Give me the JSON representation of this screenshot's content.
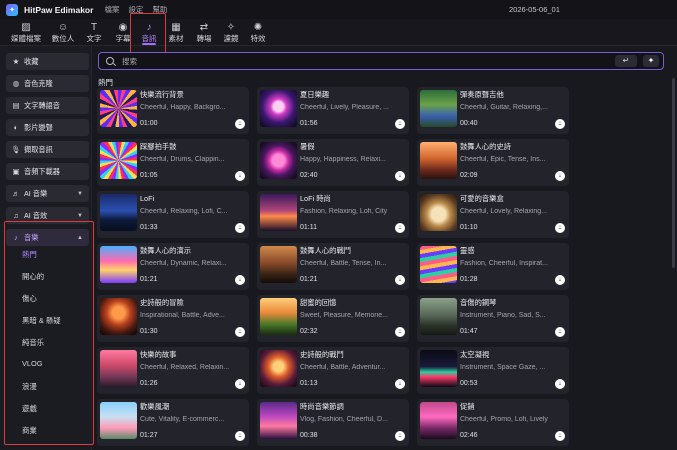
{
  "app": {
    "name": "HitPaw Edimakor",
    "menu": [
      "檔案",
      "設定",
      "幫助"
    ],
    "project_name": "2026-05-06_01"
  },
  "toolbar": [
    {
      "label": "媒體檔案",
      "icon": "media-icon"
    },
    {
      "label": "數位人",
      "icon": "avatar-icon"
    },
    {
      "label": "文字",
      "icon": "text-icon"
    },
    {
      "label": "字幕",
      "icon": "subtitle-icon"
    },
    {
      "label": "音訊",
      "icon": "music-note-icon",
      "active": true
    },
    {
      "label": "素材",
      "icon": "stickers-icon"
    },
    {
      "label": "轉場",
      "icon": "transition-icon"
    },
    {
      "label": "濾鏡",
      "icon": "filter-icon"
    },
    {
      "label": "特效",
      "icon": "effects-icon"
    }
  ],
  "sidebar": {
    "buttons": [
      {
        "label": "收藏",
        "icon": "star-icon"
      },
      {
        "label": "音色克隆",
        "icon": "voice-clone-icon"
      },
      {
        "label": "文字轉語音",
        "icon": "tts-icon"
      },
      {
        "label": "影片變聲",
        "icon": "voice-changer-icon"
      },
      {
        "label": "擷取音訊",
        "icon": "microphone-icon"
      },
      {
        "label": "音頻下載器",
        "icon": "download-icon"
      },
      {
        "label": "AI 音樂",
        "icon": "ai-music-icon",
        "dropdown": true
      },
      {
        "label": "AI 音效",
        "icon": "ai-sfx-icon",
        "dropdown": true
      },
      {
        "label": "音樂",
        "icon": "music-note-icon",
        "dropdown": true,
        "open": true
      }
    ],
    "sub_items": [
      "熱門",
      "開心的",
      "傷心",
      "黑暗 & 懸疑",
      "純音乐",
      "VLOG",
      "浪漫",
      "遊戲",
      "商業"
    ],
    "active_sub": "熱門"
  },
  "search": {
    "placeholder": "搜索",
    "value": ""
  },
  "section_title": "熱門",
  "tracks": [
    {
      "title": "快樂流行背景",
      "tags": "Cheerful, Happy, Backgro...",
      "duration": "01:00"
    },
    {
      "title": "夏日樂趣",
      "tags": "Cheerful, Lively, Pleasure, ...",
      "duration": "01:56"
    },
    {
      "title": "彈奏原聲吉他",
      "tags": "Cheerful, Guitar, Relaxing,...",
      "duration": "00:40"
    },
    {
      "title": "踩腳拍手鼓",
      "tags": "Cheerful, Drums, Clappin...",
      "duration": "01:05"
    },
    {
      "title": "暑假",
      "tags": "Happy, Happiness, Relaxi...",
      "duration": "02:40"
    },
    {
      "title": "鼓舞人心的史詩",
      "tags": "Cheerful, Epic, Tense, Ins...",
      "duration": "02:09"
    },
    {
      "title": "LoFi",
      "tags": "Cheerful, Relaxing, Lofi, C...",
      "duration": "01:33"
    },
    {
      "title": "LoFi 時尚",
      "tags": "Fashion, Relaxing, Lofi, City",
      "duration": "01:11"
    },
    {
      "title": "可愛的音樂盒",
      "tags": "Cheerful, Lovely, Relaxing...",
      "duration": "01:10"
    },
    {
      "title": "鼓舞人心的演示",
      "tags": "Cheerful, Dynamic, Relaxi...",
      "duration": "01:21"
    },
    {
      "title": "鼓舞人心的戰鬥",
      "tags": "Cheerful, Battle, Tense, In...",
      "duration": "01:21"
    },
    {
      "title": "靈感",
      "tags": "Fashion, Cheerful, Inspirat...",
      "duration": "01:28"
    },
    {
      "title": "史詩般的冒險",
      "tags": "Inspirational, Battle, Adve...",
      "duration": "01:30"
    },
    {
      "title": "甜蜜的回憶",
      "tags": "Sweet, Pleasure, Memorie...",
      "duration": "02:32"
    },
    {
      "title": "音傷的鋼琴",
      "tags": "Instrument, Piano, Sad, S...",
      "duration": "01:47"
    },
    {
      "title": "快樂的故事",
      "tags": "Cheerful, Relaxed, Relaxin...",
      "duration": "01:26"
    },
    {
      "title": "史詩般的戰鬥",
      "tags": "Cheerful, Battle, Adventur...",
      "duration": "01:13"
    },
    {
      "title": "太空凝視",
      "tags": "Instrument, Space Gaze, ...",
      "duration": "00:53"
    },
    {
      "title": "歡樂風潮",
      "tags": "Cute, Vitality, E-commerc...",
      "duration": "01:27"
    },
    {
      "title": "時尚音樂節調",
      "tags": "Vlog, Fashion, Cheerful, D...",
      "duration": "00:38"
    },
    {
      "title": "促銷",
      "tags": "Cheerful, Promo, Lofi, Lively",
      "duration": "02:46"
    }
  ]
}
